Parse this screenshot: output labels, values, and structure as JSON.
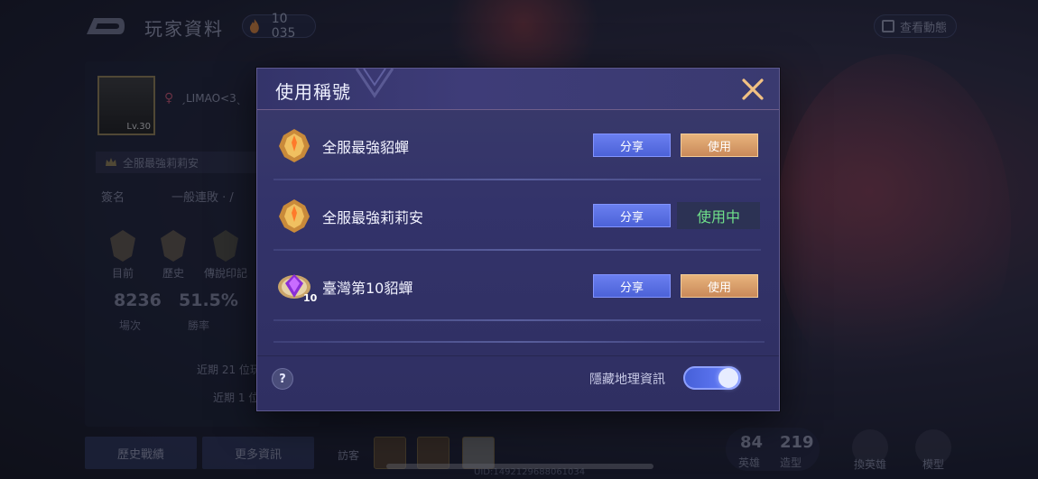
{
  "header": {
    "page_title": "玩家資料",
    "currency_value": "10 035",
    "dynamics_label": "查看動態"
  },
  "profile": {
    "level": "Lv.30",
    "name": "ˏLIMAO<3ˎ",
    "current_title": "全服最強莉莉安",
    "sign_label": "簽名",
    "sign_value": "一般連敗 · /",
    "rank_labels": [
      "目前",
      "歷史",
      "傳說印記"
    ],
    "games_value": "8236",
    "games_label": "場次",
    "winrate_value": "51.5%",
    "winrate_label": "勝率",
    "recent_21": "近期 21 位玩",
    "recent_1": "近期 1 位",
    "history_button": "歷史戰績",
    "more_button": "更多資訊",
    "visitor_label": "訪客",
    "uid": "UID:1492129688061034"
  },
  "stats": {
    "heroes_count": "84",
    "heroes_label": "英雄",
    "skins_count": "219",
    "skins_label": "造型",
    "hero_nav_label": "換英雄",
    "model_nav_label": "模型"
  },
  "modal": {
    "title": "使用稱號",
    "items": [
      {
        "name": "全服最強貂蟬",
        "share": "分享",
        "action": "使用",
        "state": "available"
      },
      {
        "name": "全服最強莉莉安",
        "share": "分享",
        "action": "使用中",
        "state": "in-use"
      },
      {
        "name": "臺灣第10貂蟬",
        "share": "分享",
        "action": "使用",
        "state": "available",
        "badge_number": "10"
      }
    ],
    "help": "?",
    "toggle_label": "隱藏地理資訊",
    "toggle_on": true
  },
  "colors": {
    "share_button": "#5a70e4",
    "use_button": "#d9a06a",
    "in_use_text": "#6fe08a",
    "modal_bg": "#33336a"
  }
}
